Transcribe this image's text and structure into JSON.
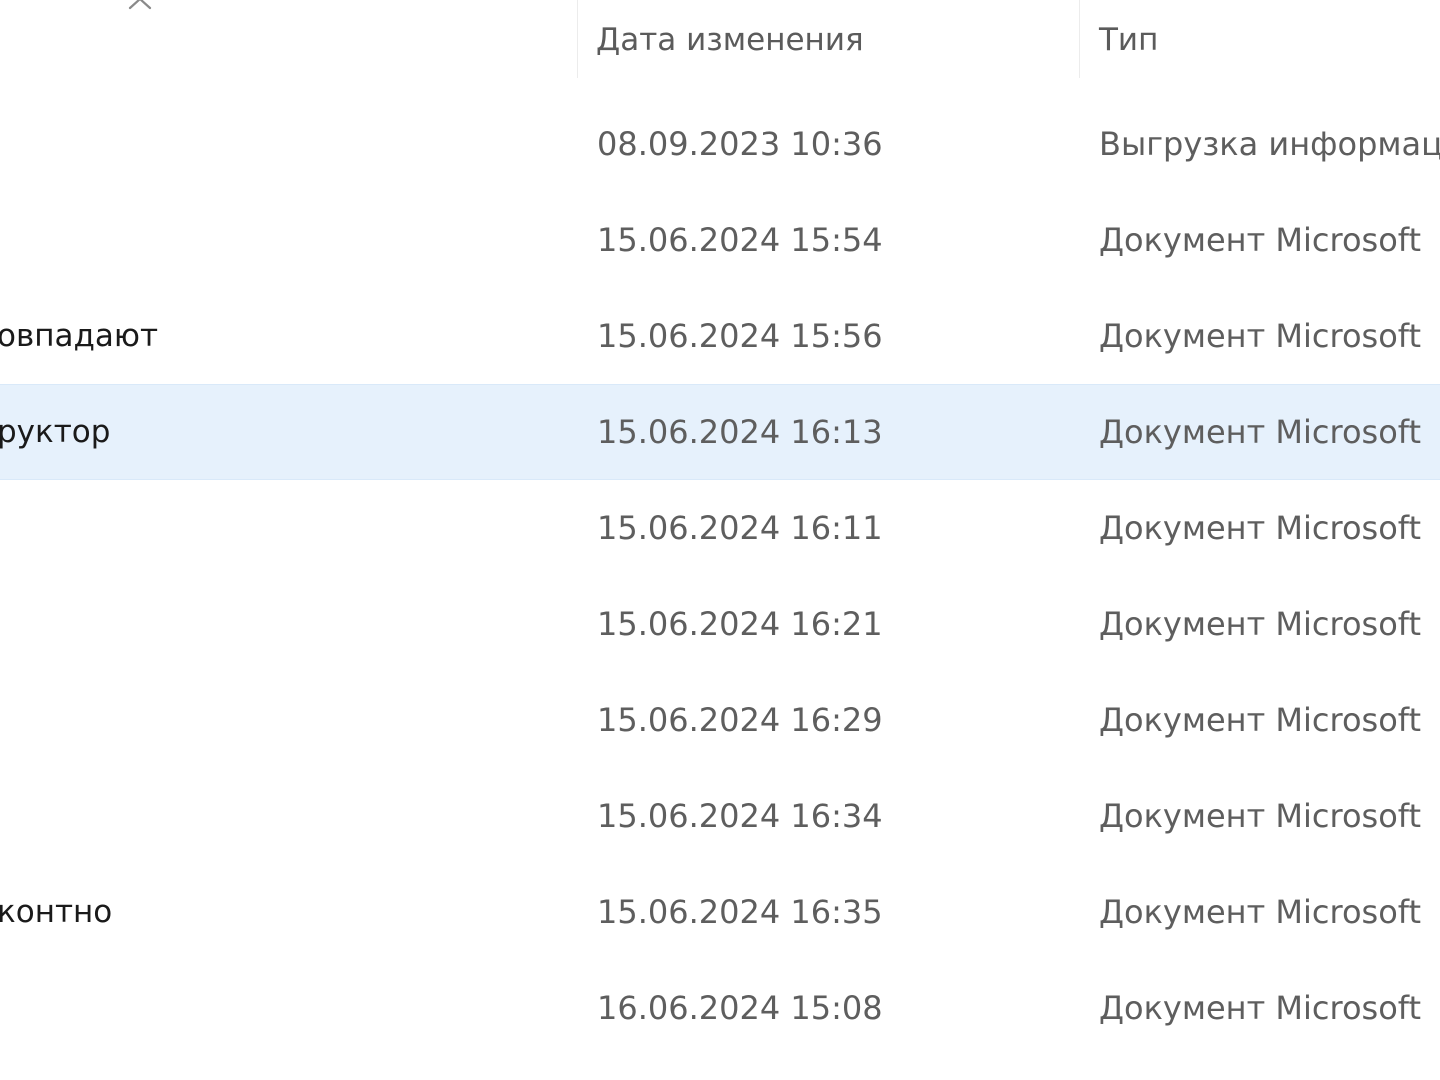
{
  "header": {
    "columns": {
      "date": "Дата изменения",
      "type": "Тип"
    }
  },
  "rows": [
    {
      "name": "",
      "date": "08.09.2023 10:36",
      "type": "Выгрузка информац"
    },
    {
      "name": "",
      "date": "15.06.2024 15:54",
      "type": "Документ Microsoft"
    },
    {
      "name": "овпадают",
      "date": "15.06.2024 15:56",
      "type": "Документ Microsoft"
    },
    {
      "name": "руктор",
      "date": "15.06.2024 16:13",
      "type": "Документ Microsoft",
      "selected": true
    },
    {
      "name": "",
      "date": "15.06.2024 16:11",
      "type": "Документ Microsoft"
    },
    {
      "name": "",
      "date": "15.06.2024 16:21",
      "type": "Документ Microsoft"
    },
    {
      "name": "",
      "date": "15.06.2024 16:29",
      "type": "Документ Microsoft"
    },
    {
      "name": "",
      "date": "15.06.2024 16:34",
      "type": "Документ Microsoft"
    },
    {
      "name": "контно",
      "date": "15.06.2024 16:35",
      "type": "Документ Microsoft"
    },
    {
      "name": "",
      "date": "16.06.2024 15:08",
      "type": "Документ Microsoft"
    }
  ],
  "icons": {
    "sort": "chevron-up-icon"
  },
  "colors": {
    "selected_row": "#e6f1fc",
    "header_text": "#5b5b5b",
    "secondary_text": "#5e5e5e",
    "primary_text": "#1a1a1a"
  }
}
